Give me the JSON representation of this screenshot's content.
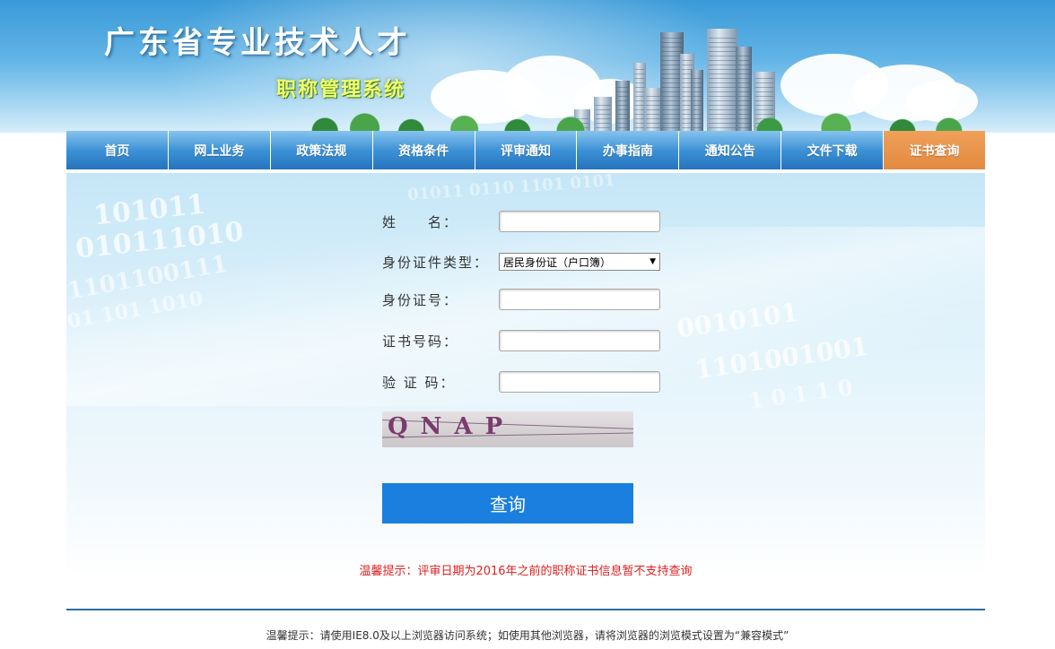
{
  "header": {
    "title": "广东省专业技术人才",
    "subtitle": "职称管理系统"
  },
  "nav": {
    "items": [
      {
        "label": "首页",
        "name": "nav-home"
      },
      {
        "label": "网上业务",
        "name": "nav-online-business"
      },
      {
        "label": "政策法规",
        "name": "nav-policy"
      },
      {
        "label": "资格条件",
        "name": "nav-qualification"
      },
      {
        "label": "评审通知",
        "name": "nav-review-notice"
      },
      {
        "label": "办事指南",
        "name": "nav-guide"
      },
      {
        "label": "通知公告",
        "name": "nav-announcement"
      },
      {
        "label": "文件下载",
        "name": "nav-download"
      },
      {
        "label": "证书查询",
        "name": "nav-certificate-query",
        "active": true
      }
    ],
    "active_color": "#e28a3f",
    "bar_color": "#3e92d6"
  },
  "form": {
    "name_label": "姓　　名：",
    "name_value": "",
    "id_type_label": "身份证件类型：",
    "id_type_selected": "居民身份证（户口簿）",
    "id_number_label": "身份证号：",
    "id_number_value": "",
    "cert_number_label": "证书号码：",
    "cert_number_value": "",
    "captcha_label": "验 证 码：",
    "captcha_value": "",
    "captcha_image_text": "QNAP",
    "submit_label": "查询"
  },
  "notice": "温馨提示：评审日期为2016年之前的职称证书信息暂不支持查询",
  "footer": "温馨提示：请使用IE8.0及以上浏览器访问系统；如使用其他浏览器，请将浏览器的浏览模式设置为“兼容模式”",
  "colors": {
    "button": "#1a7fde",
    "notice": "#e02020",
    "divider": "#2a6fa7"
  },
  "icons": {
    "select_arrow": "chevron-down-icon"
  }
}
